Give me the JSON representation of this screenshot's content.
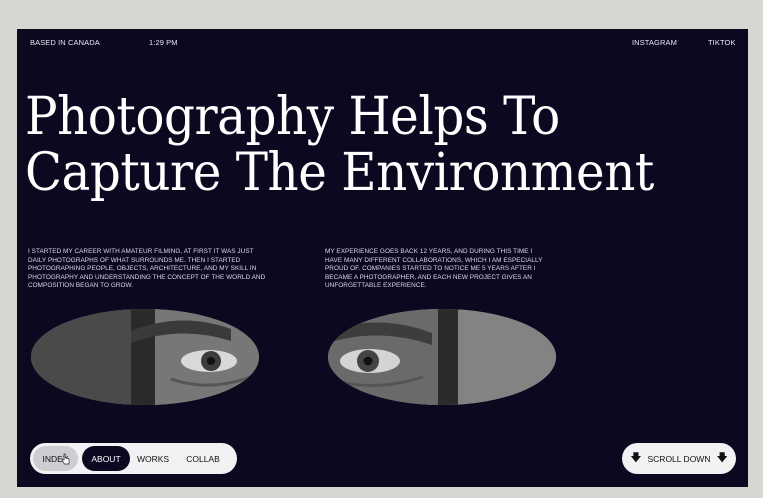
{
  "top_bar": {
    "location": "BASED IN CANADA",
    "time": "1:29 PM",
    "links": [
      "INSTAGRAM",
      "TIKTOK"
    ]
  },
  "hero": {
    "line1": "Photography Helps To",
    "line2": "Capture The Environment"
  },
  "paragraphs": [
    "I STARTED MY CAREER WITH AMATEUR FILMING, AT FIRST IT WAS JUST DAILY PHOTOGRAPHS OF WHAT SURROUNDS ME. THEN I STARTED PHOTOGRAPHING PEOPLE, OBJECTS, ARCHITECTURE, AND MY SKILL IN PHOTOGRAPHY AND UNDERSTANDING THE CONCEPT OF THE WORLD AND COMPOSITION BEGAN TO GROW.",
    "MY EXPERIENCE GOES BACK 12 YEARS, AND DURING THIS TIME I HAVE MANY DIFFERENT COLLABORATIONS, WHICH I AM ESPECIALLY PROUD OF. COMPANIES STARTED TO NOTICE ME 5 YEARS AFTER I BECAME A PHOTOGRAPHER, AND EACH NEW PROJECT GIVES AN UNFORGETTABLE EXPERIENCE."
  ],
  "nav": {
    "items": [
      "INDEX",
      "ABOUT",
      "WORKS",
      "COLLAB"
    ],
    "active": "ABOUT",
    "hovered": "INDEX"
  },
  "scroll_button": {
    "label": "SCROLL DOWN",
    "icon": "arrow-down-icon"
  },
  "colors": {
    "background": "#0d0820",
    "outer": "#d8d6d2",
    "pill": "#f2f1f3",
    "text_light": "#ffffff"
  }
}
